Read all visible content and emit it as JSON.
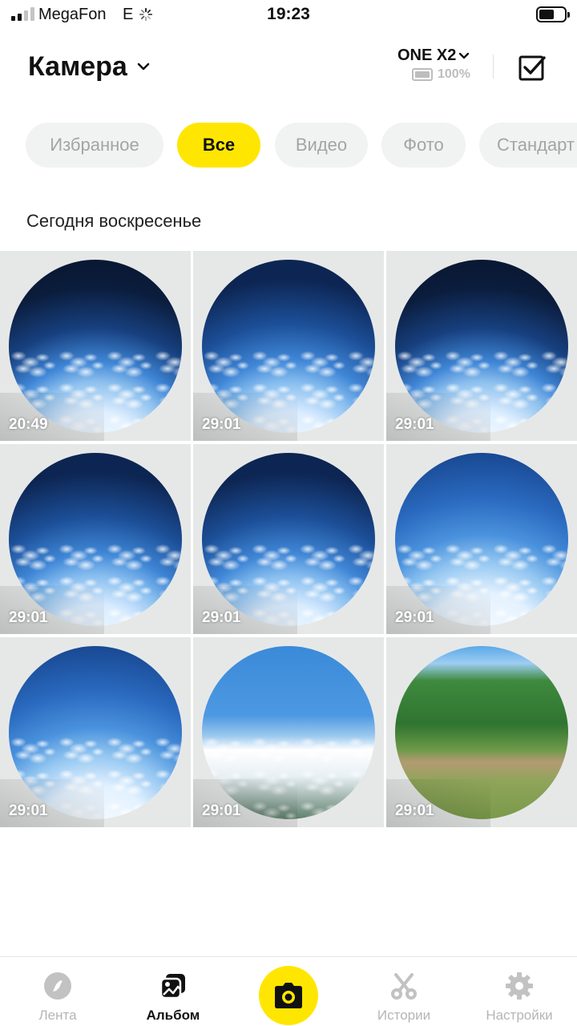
{
  "status_bar": {
    "carrier": "MegaFon",
    "network": "E",
    "time": "19:23"
  },
  "header": {
    "title": "Камера",
    "device_name": "ONE X2",
    "device_battery": "100%"
  },
  "filters": [
    {
      "label": "Избранное",
      "active": false
    },
    {
      "label": "Все",
      "active": true
    },
    {
      "label": "Видео",
      "active": false
    },
    {
      "label": "Фото",
      "active": false
    },
    {
      "label": "Стандарт",
      "active": false
    }
  ],
  "section": {
    "label": "Сегодня воскресенье"
  },
  "media": [
    {
      "duration": "20:49",
      "scene": "stratosphere-horizon"
    },
    {
      "duration": "29:01",
      "scene": "stratosphere-horizon"
    },
    {
      "duration": "29:01",
      "scene": "stratosphere-horizon"
    },
    {
      "duration": "29:01",
      "scene": "high-altitude-clouds"
    },
    {
      "duration": "29:01",
      "scene": "high-altitude-clouds"
    },
    {
      "duration": "29:01",
      "scene": "high-altitude-clouds"
    },
    {
      "duration": "29:01",
      "scene": "sky-over-clouds"
    },
    {
      "duration": "29:01",
      "scene": "sky-over-clouds"
    },
    {
      "duration": "29:01",
      "scene": "forest-dirt-road"
    }
  ],
  "tabbar": {
    "items": [
      {
        "label": "Лента",
        "icon": "compass-icon",
        "active": false
      },
      {
        "label": "Альбом",
        "icon": "album-icon",
        "active": true
      },
      {
        "label": "Истории",
        "icon": "scissors-icon",
        "active": false
      },
      {
        "label": "Настройки",
        "icon": "gear-icon",
        "active": false
      }
    ],
    "camera_button_icon": "camera-icon"
  },
  "colors": {
    "accent": "#ffe600",
    "chip_background": "#f1f2f2",
    "inactive_text": "#b5b5b5",
    "text": "#111111"
  }
}
